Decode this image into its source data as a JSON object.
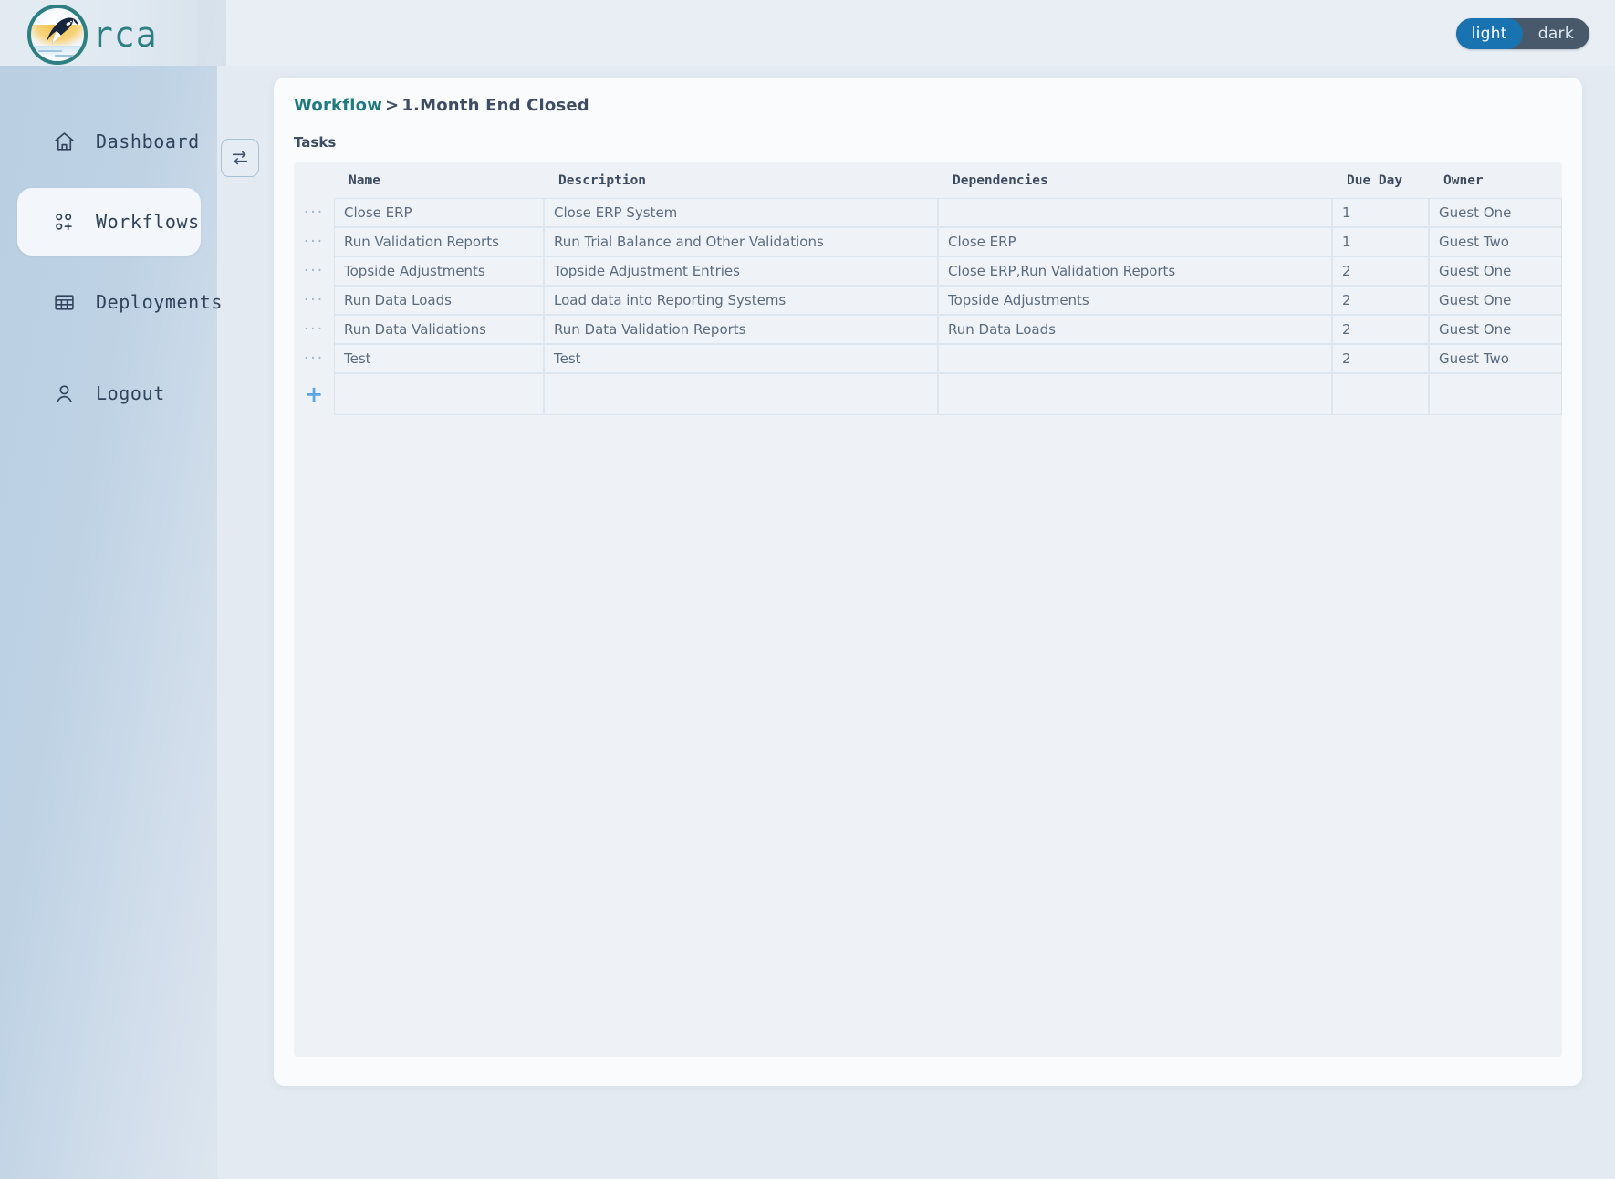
{
  "app": {
    "logo_word": "rca",
    "logo_icon": "orca-logo-icon"
  },
  "topbar": {
    "theme_toggle": {
      "light_label": "light",
      "dark_label": "dark",
      "selected": "light"
    }
  },
  "sidebar": {
    "collapse_button_icon": "swap-arrows-icon",
    "items": [
      {
        "label": "Dashboard",
        "icon": "home-icon",
        "active": false
      },
      {
        "label": "Workflows",
        "icon": "workflows-icon",
        "active": true
      },
      {
        "label": "Deployments",
        "icon": "table-icon",
        "active": false
      },
      {
        "label": "Logout",
        "icon": "user-icon",
        "active": false
      }
    ]
  },
  "main": {
    "breadcrumb": {
      "root": "Workflow",
      "separator": ">",
      "current": "1.Month End Closed"
    },
    "section_label": "Tasks",
    "table": {
      "row_handle_glyph": "···",
      "add_row_glyph": "+",
      "columns": [
        "Name",
        "Description",
        "Dependencies",
        "Due Day",
        "Owner"
      ],
      "rows": [
        {
          "name": "Close ERP",
          "description": "Close ERP System",
          "dependencies": "",
          "due_day": "1",
          "owner": "Guest One"
        },
        {
          "name": "Run Validation Reports",
          "description": "Run Trial Balance and Other Validations",
          "dependencies": "Close ERP",
          "due_day": "1",
          "owner": "Guest Two"
        },
        {
          "name": "Topside Adjustments",
          "description": "Topside Adjustment Entries",
          "dependencies": "Close ERP,Run Validation Reports",
          "due_day": "2",
          "owner": "Guest One"
        },
        {
          "name": "Run Data Loads",
          "description": "Load data into Reporting Systems",
          "dependencies": "Topside Adjustments",
          "due_day": "2",
          "owner": "Guest One"
        },
        {
          "name": "Run Data Validations",
          "description": "Run Data Validation Reports",
          "dependencies": "Run Data Loads",
          "due_day": "2",
          "owner": "Guest One"
        },
        {
          "name": "Test",
          "description": "Test",
          "dependencies": "",
          "due_day": "2",
          "owner": "Guest Two"
        }
      ]
    }
  },
  "colors": {
    "brand_teal": "#2e7f82",
    "accent_blue": "#1873b0",
    "add_blue": "#5aa6e0",
    "page_bg": "#e4eaf1",
    "card_bg": "#f9fbfd",
    "table_bg": "#eef2f7"
  }
}
